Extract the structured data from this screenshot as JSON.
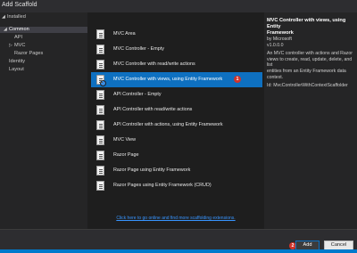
{
  "window": {
    "title": "Add Scaffold"
  },
  "tree": {
    "root": "Installed",
    "items": [
      {
        "label": "Common",
        "expanded": true,
        "selected": true
      },
      {
        "label": "API"
      },
      {
        "label": "MVC",
        "collapsed": true
      },
      {
        "label": "Razor Pages"
      },
      {
        "label": "Identity"
      },
      {
        "label": "Layout"
      }
    ]
  },
  "templates": [
    {
      "label": "MVC Area"
    },
    {
      "label": "MVC Controller - Empty"
    },
    {
      "label": "MVC Controller with read/write actions"
    },
    {
      "label": "MVC Controller with views, using Entity Framework",
      "selected": true
    },
    {
      "label": "API Controller - Empty"
    },
    {
      "label": "API Controller with read/write actions"
    },
    {
      "label": "API Controller with actions, using Entity Framework"
    },
    {
      "label": "MVC View"
    },
    {
      "label": "Razor Page"
    },
    {
      "label": "Razor Page using Entity Framework"
    },
    {
      "label": "Razor Pages using Entity Framework (CRUD)"
    }
  ],
  "details": {
    "title_line1": "MVC Controller with views, using Entity",
    "title_line2": "Framework",
    "author": "by Microsoft",
    "version": "v1.0.0.0",
    "desc_lines": [
      "An MVC controller with actions and Razor",
      "views to create, read, update, delete, and list",
      "entities from an Entity Framework data",
      "context."
    ],
    "id": "Id: MvcControllerWithContextScaffolder"
  },
  "online_link": "Click here to go online and find more scaffolding extensions.",
  "buttons": {
    "add": "Add",
    "cancel": "Cancel"
  },
  "step_badges": {
    "first": "1",
    "second": "2"
  },
  "colors": {
    "selection": "#0e70c0",
    "badge": "#d0342c",
    "link": "#3794ff"
  }
}
